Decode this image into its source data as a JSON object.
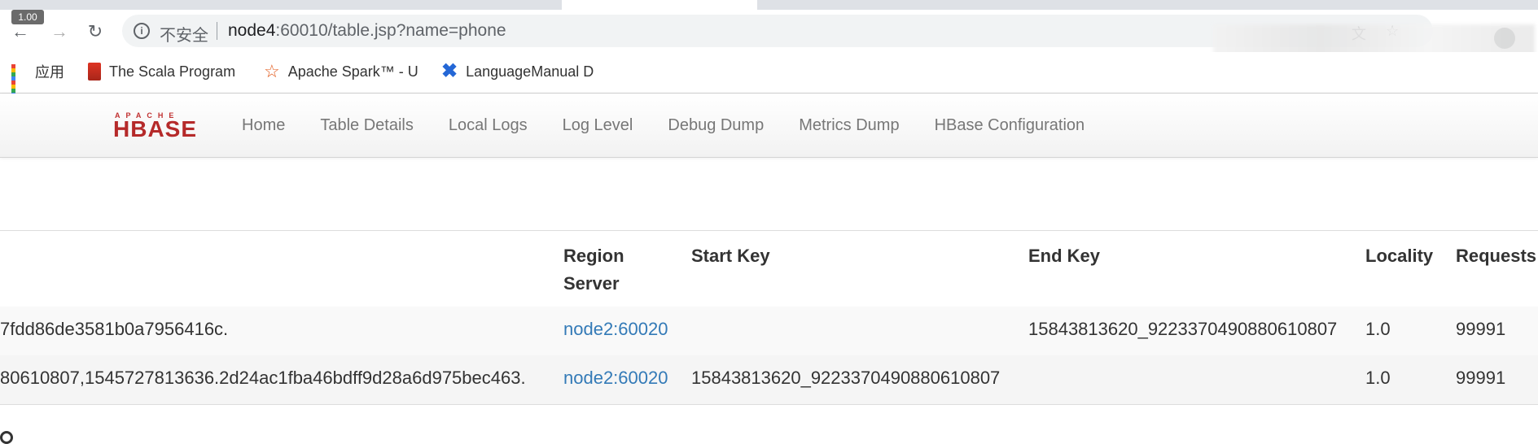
{
  "browser": {
    "zoom_badge": "1.00",
    "insecure_label": "不安全",
    "url_host": "node4",
    "url_rest": ":60010/table.jsp?name=phone",
    "icons": [
      "back-icon",
      "forward-icon",
      "reload-icon",
      "info-icon",
      "translate-icon",
      "star-icon",
      "extension-icon",
      "profile-icon"
    ]
  },
  "bookmarks": [
    {
      "label": "应用",
      "icon": "apps-icon"
    },
    {
      "label": "The Scala Program",
      "icon": "scala-icon"
    },
    {
      "label": "Apache Spark™ - U",
      "icon": "spark-icon"
    },
    {
      "label": "LanguageManual D",
      "icon": "confluence-icon"
    }
  ],
  "navbar": {
    "logo_top": "APACHE",
    "logo_main": "HBASE",
    "links": [
      "Home",
      "Table Details",
      "Local Logs",
      "Log Level",
      "Debug Dump",
      "Metrics Dump",
      "HBase Configuration"
    ]
  },
  "table": {
    "headers": {
      "name": "",
      "region_server_line1": "Region",
      "region_server_line2": "Server",
      "start_key": "Start Key",
      "end_key": "End Key",
      "locality": "Locality",
      "requests": "Requests"
    },
    "rows": [
      {
        "name": "7fdd86de3581b0a7956416c.",
        "region_server": "node2:60020",
        "start_key": "",
        "end_key": "15843813620_9223370490880610807",
        "locality": "1.0",
        "requests": "99991"
      },
      {
        "name": "80610807,1545727813636.2d24ac1fba46bdff9d28a6d975bec463.",
        "region_server": "node2:60020",
        "start_key": "15843813620_9223370490880610807",
        "end_key": "",
        "locality": "1.0",
        "requests": "99991"
      }
    ]
  },
  "colors": {
    "link": "#337ab7",
    "hbase_red": "#b52a2a"
  }
}
